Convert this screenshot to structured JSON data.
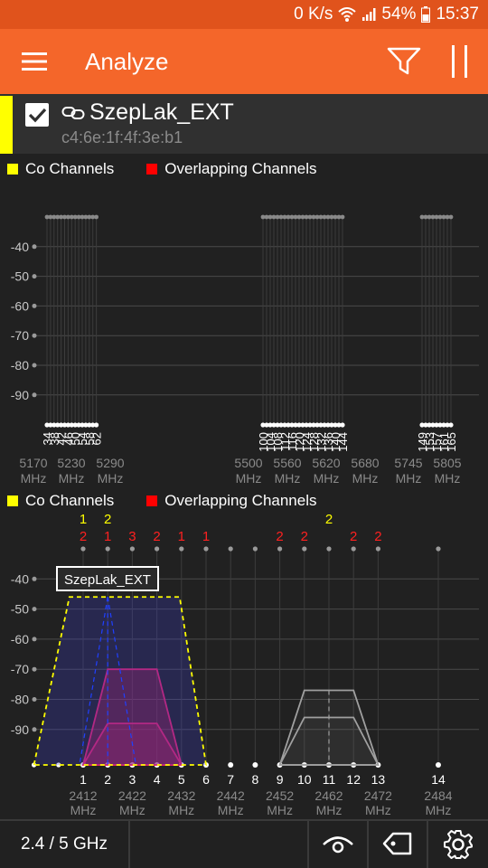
{
  "status_bar": {
    "speed": "0 K/s",
    "battery": "54%",
    "time": "15:37"
  },
  "app_bar": {
    "title": "Analyze"
  },
  "access_point": {
    "ssid": "SzepLak_EXT",
    "bssid": "c4:6e:1f:4f:3e:b1",
    "color": "#ffff00",
    "checked": true
  },
  "legend": {
    "co": "Co Channels",
    "overlap": "Overlapping Channels",
    "co_color": "#ffff00",
    "overlap_color": "#ff0000"
  },
  "chart_data": [
    {
      "type": "line",
      "band": "5 GHz",
      "yticks": [
        -40,
        -50,
        -60,
        -70,
        -80,
        -90
      ],
      "channels": [
        "34",
        "38",
        "42",
        "46",
        "50",
        "54",
        "58",
        "62",
        "100",
        "104",
        "108",
        "112",
        "116",
        "120",
        "124",
        "128",
        "132",
        "136",
        "140",
        "144",
        "149",
        "153",
        "157",
        "161",
        "165"
      ],
      "freq_labels": [
        "5170",
        "5230",
        "5290",
        "5500",
        "5560",
        "5620",
        "5680",
        "5745",
        "5805"
      ],
      "freq_unit": "MHz",
      "series": []
    },
    {
      "type": "area",
      "band": "2.4 GHz",
      "yticks": [
        -40,
        -50,
        -60,
        -70,
        -80,
        -90
      ],
      "channels": [
        "1",
        "2",
        "3",
        "4",
        "5",
        "6",
        "7",
        "8",
        "9",
        "10",
        "11",
        "12",
        "13",
        "14"
      ],
      "freq_labels": [
        "2412",
        "2422",
        "2432",
        "2442",
        "2452",
        "2462",
        "2472",
        "2484"
      ],
      "freq_unit": "MHz",
      "co_counts": {
        "1": "1",
        "2": "2",
        "11": "2"
      },
      "overlap_counts": {
        "1": "2",
        "2": "1",
        "3": "3",
        "4": "2",
        "5": "1",
        "6": "1",
        "9": "2",
        "10": "2",
        "12": "2",
        "13": "2"
      },
      "series": [
        {
          "name": "SzepLak_EXT",
          "center_channel": 2,
          "signal": -46,
          "color": "#ffff00"
        },
        {
          "center_channel": 3,
          "signal": -70,
          "color": "#e0206a"
        },
        {
          "center_channel": 3,
          "signal": -88,
          "color": "#e0206a"
        },
        {
          "center_channel": 11,
          "signal": -77,
          "color": "#9a9a9a"
        },
        {
          "center_channel": 11,
          "signal": -86,
          "color": "#9a9a9a"
        }
      ]
    }
  ],
  "bottom_bar": {
    "band_label": "2.4 / 5 GHz"
  }
}
